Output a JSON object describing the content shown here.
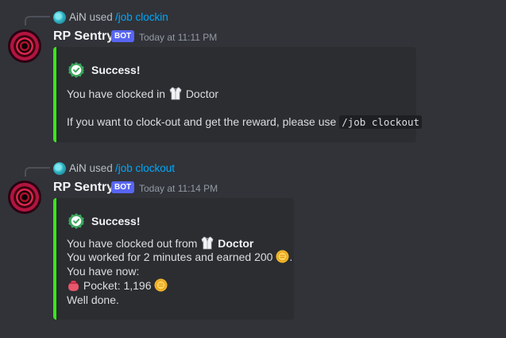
{
  "colors": {
    "background": "#313338",
    "embed_bg": "#2b2d31",
    "embed_accent": "#3ae51b",
    "command_link": "#00a8fc",
    "bot_tag": "#5865f2"
  },
  "messages": [
    {
      "reply": {
        "user": "AiN",
        "used": "used",
        "command": "/job clockin"
      },
      "author": "RP Sentry",
      "bot_tag": "BOT",
      "timestamp": "Today at 11:11 PM",
      "embed": {
        "title": "Success!",
        "line1_prefix": "You have clocked in",
        "line1_job": "Doctor",
        "line2_prefix": "If you want to clock-out and get the reward, please use",
        "line2_code": "/job clockout"
      }
    },
    {
      "reply": {
        "user": "AiN",
        "used": "used",
        "command": "/job clockout"
      },
      "author": "RP Sentry",
      "bot_tag": "BOT",
      "timestamp": "Today at 11:14 PM",
      "embed": {
        "title": "Success!",
        "line1_prefix": "You have clocked out from",
        "line1_job": "Doctor",
        "line2_text": "You worked for 2 minutes and earned 200",
        "line2_suffix": ".",
        "line3_text": "You have now:",
        "line4_text": "Pocket: 1,196",
        "line5_text": "Well done."
      }
    }
  ],
  "icons": {
    "reply_avatar": "user-avatar-icon",
    "success": "check-circle-icon",
    "job": "lab-coat-icon",
    "coin": "coin-icon",
    "pocket": "pouch-icon"
  }
}
